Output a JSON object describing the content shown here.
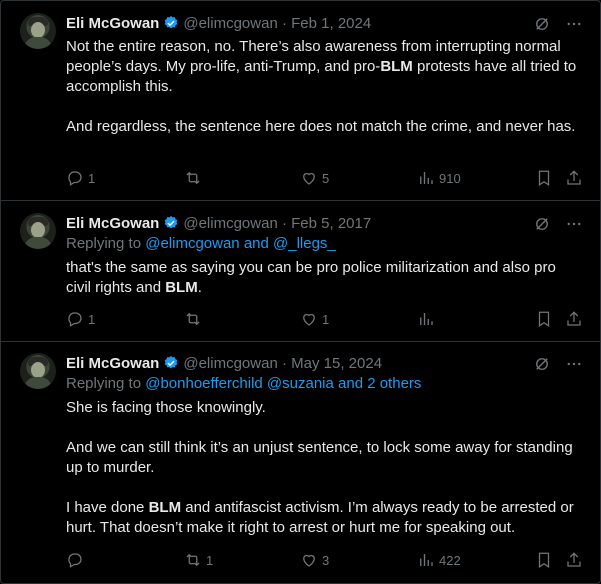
{
  "tweets": [
    {
      "author": "Eli McGowan",
      "handle": "@elimcgowan",
      "date": "Feb 1, 2024",
      "replying_to": null,
      "paragraphs": [
        [
          "Not the entire reason, no. There’s also awareness from interrupting normal people’s days. My pro-life, anti-Trump, and pro-",
          "BLM",
          " protests have all tried to accomplish this."
        ],
        [
          "And regardless, the sentence here does not match the crime, and never has.",
          "",
          ""
        ]
      ],
      "replies": "1",
      "retweets": "",
      "likes": "5",
      "views": "910"
    },
    {
      "author": "Eli McGowan",
      "handle": "@elimcgowan",
      "date": "Feb 5, 2017",
      "replying_to": {
        "prefix": "Replying to",
        "names": "@elimcgowan and @_llegs_"
      },
      "paragraphs": [
        [
          "that's the same as saying you can be pro police militarization and also pro civil rights and ",
          "BLM",
          "."
        ]
      ],
      "replies": "1",
      "retweets": "",
      "likes": "1",
      "views": ""
    },
    {
      "author": "Eli McGowan",
      "handle": "@elimcgowan",
      "date": "May 15, 2024",
      "replying_to": {
        "prefix": "Replying to",
        "names": "@bonhoefferchild @suzania and 2 others"
      },
      "paragraphs": [
        [
          "She is facing those knowingly.",
          "",
          ""
        ],
        [
          "And we can still think it’s an unjust sentence, to lock some away for standing up to murder.",
          "",
          ""
        ],
        [
          "I have done ",
          "BLM",
          " and antifascist activism. I’m always ready to be arrested or hurt. That doesn’t make it right to arrest or hurt me for speaking out."
        ]
      ],
      "replies": "",
      "retweets": "1",
      "likes": "3",
      "views": "422"
    }
  ],
  "colors": {
    "text": "#e7e9ea",
    "muted": "#71767b",
    "link": "#1d9bf0",
    "verified": "#1d9bf0",
    "border": "#2f3336"
  },
  "icons": [
    "verified-badge-icon",
    "grok-icon",
    "more-icon",
    "reply-icon",
    "retweet-icon",
    "like-icon",
    "views-icon",
    "bookmark-icon",
    "share-icon"
  ]
}
